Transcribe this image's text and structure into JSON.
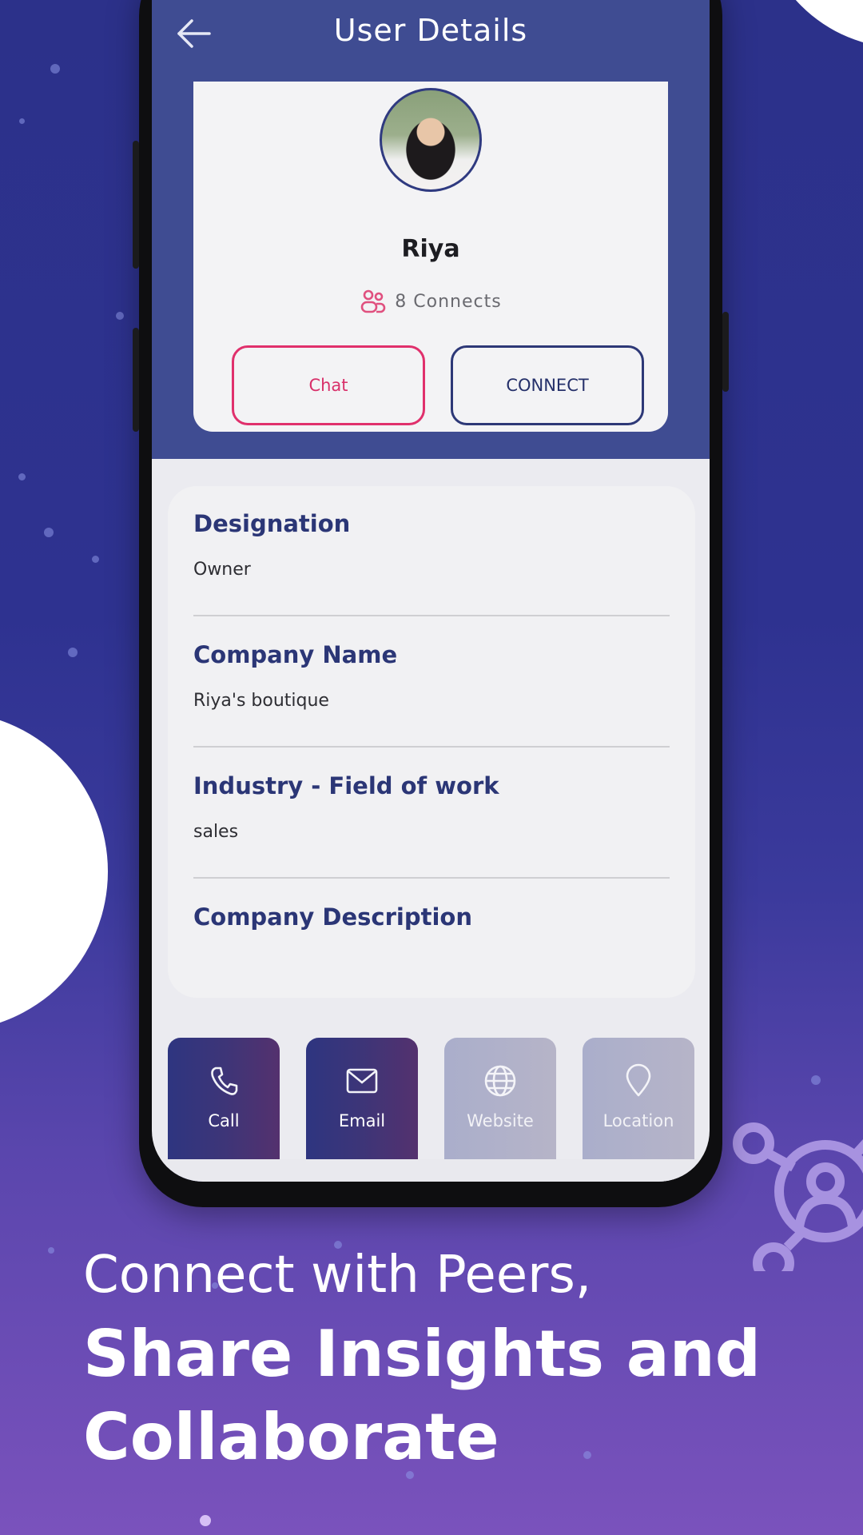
{
  "app": {
    "screen_title": "User Details"
  },
  "profile": {
    "name": "Riya",
    "connects_count": "8",
    "connects_label": "Connects",
    "connects_text": "8  Connects",
    "chat_label": "Chat",
    "connect_label": "CONNECT"
  },
  "details": [
    {
      "label": "Designation",
      "value": "Owner"
    },
    {
      "label": "Company Name",
      "value": "Riya's boutique"
    },
    {
      "label": "Industry - Field of work",
      "value": "sales"
    },
    {
      "label": "Company Description",
      "value": ""
    }
  ],
  "actions": [
    {
      "label": "Call",
      "icon": "phone-icon",
      "enabled": true
    },
    {
      "label": "Email",
      "icon": "mail-icon",
      "enabled": true
    },
    {
      "label": "Website",
      "icon": "globe-icon",
      "enabled": false
    },
    {
      "label": "Location",
      "icon": "location-pin-icon",
      "enabled": false
    }
  ],
  "promo": {
    "line1": "Connect with Peers,",
    "line2": "Share Insights and",
    "line3": "Collaborate"
  },
  "colors": {
    "header": "#3f4c92",
    "chat_accent": "#e0306c",
    "connect_accent": "#2d3877",
    "label_text": "#2b3676"
  }
}
